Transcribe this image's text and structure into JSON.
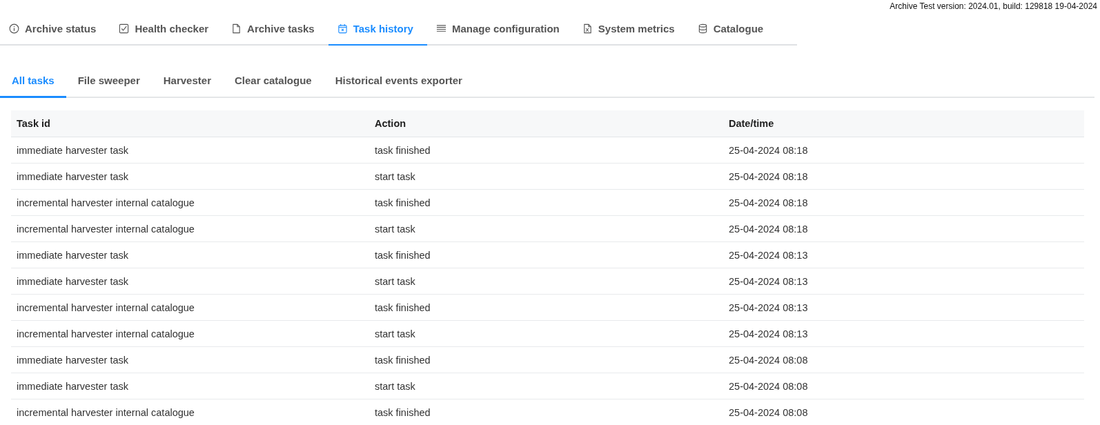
{
  "version_info": "Archive Test version: 2024.01, build: 129818 19-04-2024",
  "main_tabs": [
    {
      "label": "Archive status",
      "kind": "info",
      "selected": false
    },
    {
      "label": "Health checker",
      "kind": "check",
      "selected": false
    },
    {
      "label": "Archive tasks",
      "kind": "file",
      "selected": false
    },
    {
      "label": "Task history",
      "kind": "calendar",
      "selected": true
    },
    {
      "label": "Manage configuration",
      "kind": "lines",
      "selected": false
    },
    {
      "label": "System metrics",
      "kind": "sheet",
      "selected": false
    },
    {
      "label": "Catalogue",
      "kind": "database",
      "selected": false
    }
  ],
  "sub_tabs": [
    {
      "label": "All tasks",
      "selected": true
    },
    {
      "label": "File sweeper",
      "selected": false
    },
    {
      "label": "Harvester",
      "selected": false
    },
    {
      "label": "Clear catalogue",
      "selected": false
    },
    {
      "label": "Historical events exporter",
      "selected": false
    }
  ],
  "table": {
    "columns": [
      "Task id",
      "Action",
      "Date/time"
    ],
    "rows": [
      [
        "immediate harvester task",
        "task finished",
        "25-04-2024 08:18"
      ],
      [
        "immediate harvester task",
        "start task",
        "25-04-2024 08:18"
      ],
      [
        "incremental harvester internal catalogue",
        "task finished",
        "25-04-2024 08:18"
      ],
      [
        "incremental harvester internal catalogue",
        "start task",
        "25-04-2024 08:18"
      ],
      [
        "immediate harvester task",
        "task finished",
        "25-04-2024 08:13"
      ],
      [
        "immediate harvester task",
        "start task",
        "25-04-2024 08:13"
      ],
      [
        "incremental harvester internal catalogue",
        "task finished",
        "25-04-2024 08:13"
      ],
      [
        "incremental harvester internal catalogue",
        "start task",
        "25-04-2024 08:13"
      ],
      [
        "immediate harvester task",
        "task finished",
        "25-04-2024 08:08"
      ],
      [
        "immediate harvester task",
        "start task",
        "25-04-2024 08:08"
      ],
      [
        "incremental harvester internal catalogue",
        "task finished",
        "25-04-2024 08:08"
      ]
    ]
  }
}
